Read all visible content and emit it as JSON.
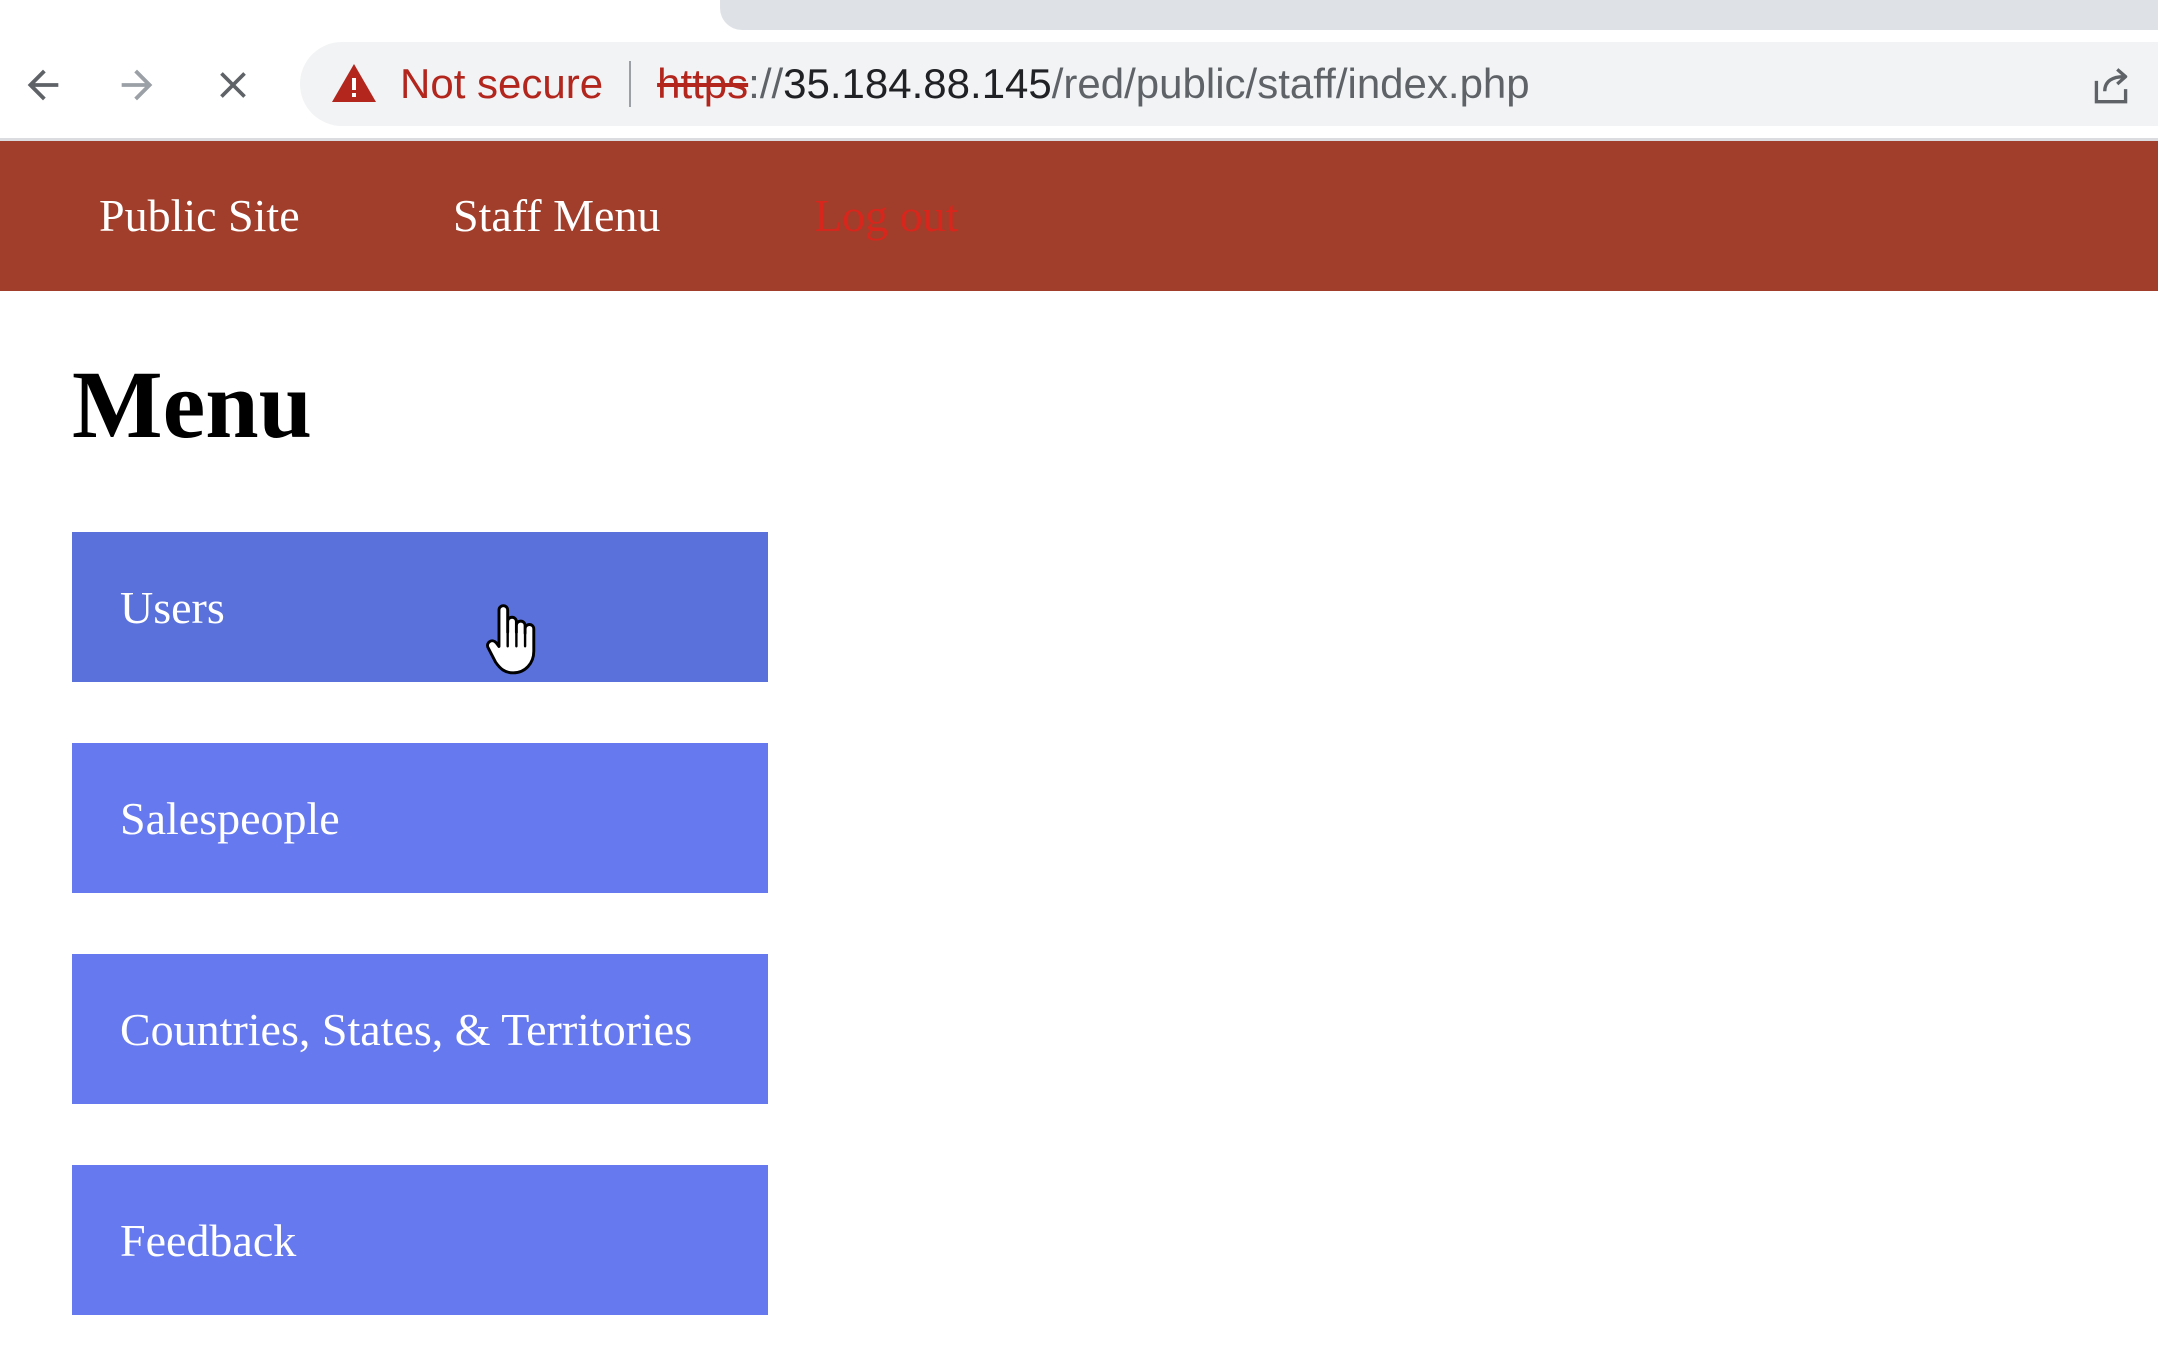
{
  "browser": {
    "security_label": "Not secure",
    "url": {
      "scheme": "https",
      "separator": "://",
      "host": "35.184.88.145",
      "path": "/red/public/staff/index.php"
    },
    "icons": {
      "back": "back-arrow-icon",
      "forward": "forward-arrow-icon",
      "stop": "stop-loading-icon",
      "security": "warning-triangle-icon",
      "share": "share-icon"
    }
  },
  "header": {
    "background_color": "#a03e2b",
    "links": {
      "public_site": "Public Site",
      "staff_menu": "Staff Menu",
      "log_out": "Log out"
    },
    "log_out_color": "#d9261c"
  },
  "main": {
    "title": "Menu",
    "menu_items": {
      "users": "Users",
      "salespeople": "Salespeople",
      "countries": "Countries, States, & Territories",
      "feedback": "Feedback"
    },
    "button_color": "#6679ef",
    "button_hover_color": "#5a71dc",
    "hovered_item": "Users"
  }
}
